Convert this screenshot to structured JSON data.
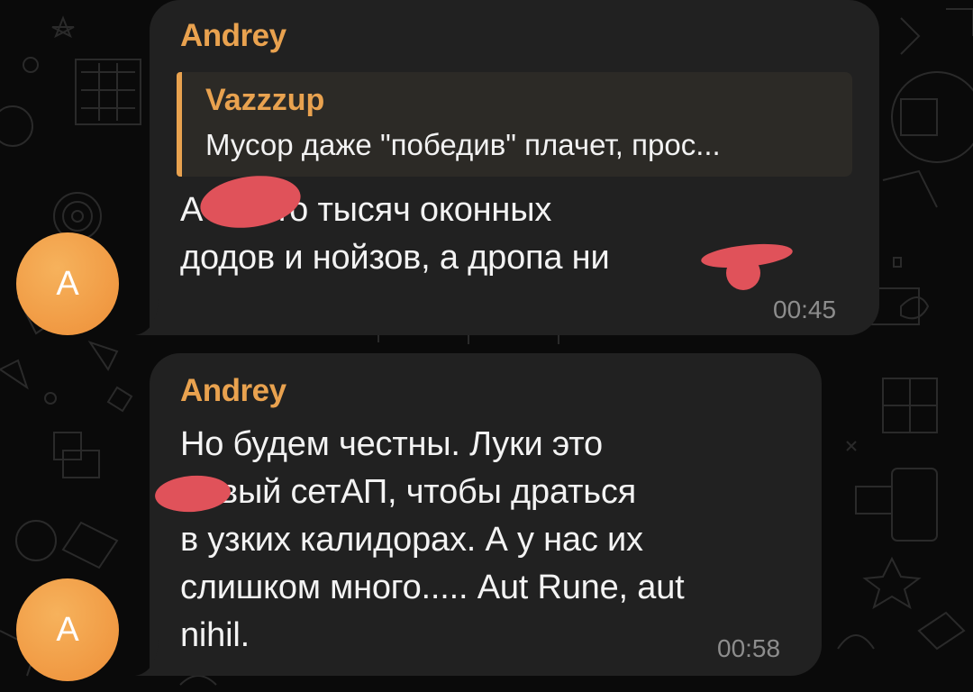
{
  "messages": [
    {
      "sender": "Andrey",
      "reply": {
        "author": "Vazzzup",
        "text": "Мусор даже \"победив\" плачет, прос..."
      },
      "lines": [
        "А      е. Сто тысяч оконных",
        "додов и нойзов, а дропа ни"
      ],
      "time": "00:45",
      "avatar_letter": "A"
    },
    {
      "sender": "Andrey",
      "lines": [
        "Но будем честны. Луки это",
        "вый сетАП, чтобы драться",
        "в узких калидорах. А у нас их",
        "слишком много..... Aut Rune, aut",
        "nihil."
      ],
      "time": "00:58",
      "avatar_letter": "A"
    }
  ],
  "colors": {
    "accent": "#e9a24f",
    "bubble": "#212121",
    "avatar": "#ef9a42",
    "redaction": "#e0525a"
  }
}
